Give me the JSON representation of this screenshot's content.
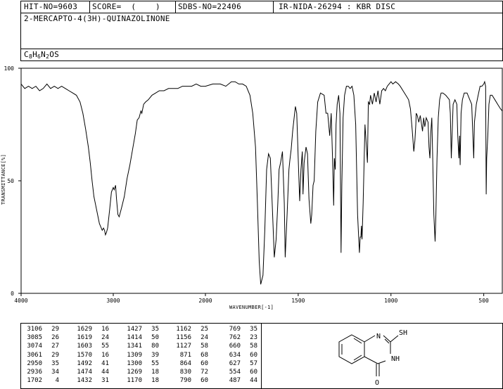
{
  "header": {
    "hit_no": "HIT-NO=9603",
    "score": "SCORE=  (    )",
    "sdbs_no": "SDBS-NO=22406",
    "ir_no": "IR-NIDA-26294 : KBR DISC",
    "compound_name": "2-MERCAPTO-4(3H)-QUINAZOLINONE",
    "formula_parts": [
      {
        "t": "C",
        "sub": false
      },
      {
        "t": "8",
        "sub": true
      },
      {
        "t": "H",
        "sub": false
      },
      {
        "t": "6",
        "sub": true
      },
      {
        "t": "N",
        "sub": false
      },
      {
        "t": "2",
        "sub": true
      },
      {
        "t": "OS",
        "sub": false
      }
    ]
  },
  "chart_data": {
    "type": "line",
    "title": "",
    "xlabel": "WAVENUMBER[-1]",
    "ylabel": "TRANSMITTANCE[%]",
    "xlim": [
      4000,
      400
    ],
    "ylim": [
      0,
      100
    ],
    "x_ticks": [
      "4000",
      "3000",
      "2000",
      "1500",
      "1000",
      "500"
    ],
    "y_ticks": [
      "100",
      "50",
      "0"
    ],
    "series": [
      {
        "points": [
          [
            4000,
            93
          ],
          [
            3960,
            91
          ],
          [
            3920,
            92
          ],
          [
            3880,
            91
          ],
          [
            3840,
            92
          ],
          [
            3800,
            90
          ],
          [
            3760,
            91
          ],
          [
            3720,
            93
          ],
          [
            3680,
            91
          ],
          [
            3640,
            92
          ],
          [
            3600,
            91
          ],
          [
            3560,
            92
          ],
          [
            3520,
            91
          ],
          [
            3480,
            90
          ],
          [
            3440,
            89
          ],
          [
            3400,
            88
          ],
          [
            3360,
            85
          ],
          [
            3330,
            80
          ],
          [
            3300,
            73
          ],
          [
            3270,
            65
          ],
          [
            3250,
            58
          ],
          [
            3230,
            50
          ],
          [
            3210,
            43
          ],
          [
            3190,
            39
          ],
          [
            3170,
            35
          ],
          [
            3150,
            31
          ],
          [
            3120,
            28
          ],
          [
            3106,
            29
          ],
          [
            3095,
            28
          ],
          [
            3085,
            26
          ],
          [
            3074,
            27
          ],
          [
            3061,
            29
          ],
          [
            3040,
            37
          ],
          [
            3020,
            45
          ],
          [
            3000,
            47
          ],
          [
            2990,
            46
          ],
          [
            2975,
            48
          ],
          [
            2965,
            42
          ],
          [
            2950,
            35
          ],
          [
            2936,
            34
          ],
          [
            2910,
            38
          ],
          [
            2880,
            43
          ],
          [
            2850,
            51
          ],
          [
            2820,
            57
          ],
          [
            2790,
            64
          ],
          [
            2760,
            71
          ],
          [
            2740,
            77
          ],
          [
            2720,
            78
          ],
          [
            2700,
            81
          ],
          [
            2690,
            80
          ],
          [
            2670,
            84
          ],
          [
            2650,
            85
          ],
          [
            2620,
            86
          ],
          [
            2580,
            88
          ],
          [
            2540,
            89
          ],
          [
            2500,
            90
          ],
          [
            2450,
            90
          ],
          [
            2400,
            91
          ],
          [
            2350,
            91
          ],
          [
            2300,
            91
          ],
          [
            2250,
            92
          ],
          [
            2200,
            92
          ],
          [
            2150,
            92
          ],
          [
            2100,
            93
          ],
          [
            2050,
            92
          ],
          [
            2000,
            92
          ],
          [
            1960,
            93
          ],
          [
            1920,
            93
          ],
          [
            1890,
            92
          ],
          [
            1860,
            94
          ],
          [
            1840,
            94
          ],
          [
            1820,
            93
          ],
          [
            1800,
            93
          ],
          [
            1780,
            92
          ],
          [
            1760,
            88
          ],
          [
            1745,
            80
          ],
          [
            1730,
            65
          ],
          [
            1720,
            40
          ],
          [
            1710,
            14
          ],
          [
            1702,
            4
          ],
          [
            1690,
            8
          ],
          [
            1680,
            28
          ],
          [
            1670,
            55
          ],
          [
            1660,
            62
          ],
          [
            1650,
            60
          ],
          [
            1640,
            40
          ],
          [
            1629,
            16
          ],
          [
            1619,
            24
          ],
          [
            1610,
            40
          ],
          [
            1603,
            55
          ],
          [
            1595,
            58
          ],
          [
            1585,
            63
          ],
          [
            1575,
            40
          ],
          [
            1570,
            16
          ],
          [
            1560,
            35
          ],
          [
            1550,
            55
          ],
          [
            1545,
            59
          ],
          [
            1538,
            64
          ],
          [
            1530,
            72
          ],
          [
            1522,
            78
          ],
          [
            1515,
            83
          ],
          [
            1508,
            80
          ],
          [
            1500,
            60
          ],
          [
            1492,
            41
          ],
          [
            1485,
            55
          ],
          [
            1478,
            63
          ],
          [
            1474,
            44
          ],
          [
            1468,
            58
          ],
          [
            1458,
            65
          ],
          [
            1450,
            62
          ],
          [
            1442,
            42
          ],
          [
            1432,
            31
          ],
          [
            1427,
            35
          ],
          [
            1420,
            48
          ],
          [
            1414,
            50
          ],
          [
            1405,
            72
          ],
          [
            1395,
            85
          ],
          [
            1380,
            89
          ],
          [
            1360,
            88
          ],
          [
            1350,
            80
          ],
          [
            1341,
            80
          ],
          [
            1330,
            70
          ],
          [
            1322,
            80
          ],
          [
            1315,
            60
          ],
          [
            1309,
            39
          ],
          [
            1305,
            60
          ],
          [
            1300,
            55
          ],
          [
            1296,
            75
          ],
          [
            1290,
            84
          ],
          [
            1282,
            88
          ],
          [
            1275,
            80
          ],
          [
            1270,
            30
          ],
          [
            1269,
            18
          ],
          [
            1265,
            48
          ],
          [
            1258,
            78
          ],
          [
            1250,
            88
          ],
          [
            1240,
            92
          ],
          [
            1230,
            92
          ],
          [
            1220,
            91
          ],
          [
            1210,
            92
          ],
          [
            1200,
            88
          ],
          [
            1190,
            75
          ],
          [
            1180,
            35
          ],
          [
            1170,
            18
          ],
          [
            1166,
            25
          ],
          [
            1162,
            25
          ],
          [
            1159,
            30
          ],
          [
            1156,
            24
          ],
          [
            1150,
            40
          ],
          [
            1140,
            75
          ],
          [
            1127,
            58
          ],
          [
            1122,
            85
          ],
          [
            1115,
            84
          ],
          [
            1110,
            88
          ],
          [
            1100,
            84
          ],
          [
            1090,
            89
          ],
          [
            1080,
            85
          ],
          [
            1070,
            90
          ],
          [
            1060,
            84
          ],
          [
            1050,
            90
          ],
          [
            1040,
            91
          ],
          [
            1030,
            90
          ],
          [
            1020,
            92
          ],
          [
            1010,
            93
          ],
          [
            1000,
            94
          ],
          [
            990,
            93
          ],
          [
            975,
            94
          ],
          [
            960,
            93
          ],
          [
            950,
            92
          ],
          [
            935,
            90
          ],
          [
            920,
            88
          ],
          [
            905,
            86
          ],
          [
            895,
            82
          ],
          [
            885,
            72
          ],
          [
            877,
            63
          ],
          [
            871,
            68
          ],
          [
            866,
            75
          ],
          [
            864,
            80
          ],
          [
            858,
            79
          ],
          [
            850,
            76
          ],
          [
            842,
            79
          ],
          [
            830,
            72
          ],
          [
            824,
            78
          ],
          [
            818,
            74
          ],
          [
            810,
            78
          ],
          [
            800,
            76
          ],
          [
            795,
            65
          ],
          [
            790,
            60
          ],
          [
            785,
            72
          ],
          [
            780,
            78
          ],
          [
            775,
            60
          ],
          [
            769,
            35
          ],
          [
            765,
            28
          ],
          [
            762,
            23
          ],
          [
            758,
            35
          ],
          [
            752,
            60
          ],
          [
            745,
            78
          ],
          [
            738,
            86
          ],
          [
            730,
            89
          ],
          [
            720,
            89
          ],
          [
            705,
            88
          ],
          [
            695,
            87
          ],
          [
            685,
            86
          ],
          [
            680,
            80
          ],
          [
            675,
            60
          ],
          [
            670,
            72
          ],
          [
            665,
            84
          ],
          [
            655,
            86
          ],
          [
            645,
            84
          ],
          [
            640,
            70
          ],
          [
            634,
            60
          ],
          [
            630,
            70
          ],
          [
            627,
            57
          ],
          [
            622,
            80
          ],
          [
            615,
            86
          ],
          [
            605,
            89
          ],
          [
            590,
            89
          ],
          [
            575,
            86
          ],
          [
            565,
            84
          ],
          [
            554,
            60
          ],
          [
            550,
            76
          ],
          [
            540,
            84
          ],
          [
            530,
            88
          ],
          [
            520,
            92
          ],
          [
            510,
            92
          ],
          [
            500,
            93
          ],
          [
            495,
            94
          ],
          [
            490,
            92
          ],
          [
            487,
            44
          ],
          [
            484,
            60
          ],
          [
            478,
            70
          ],
          [
            472,
            84
          ],
          [
            465,
            88
          ],
          [
            455,
            88
          ],
          [
            440,
            86
          ],
          [
            425,
            84
          ],
          [
            410,
            82
          ],
          [
            400,
            81
          ]
        ]
      }
    ]
  },
  "peak_table": {
    "columns": [
      [
        [
          "3106",
          "29"
        ],
        [
          "3085",
          "26"
        ],
        [
          "3074",
          "27"
        ],
        [
          "3061",
          "29"
        ],
        [
          "2950",
          "35"
        ],
        [
          "2936",
          "34"
        ],
        [
          "1702",
          "4"
        ]
      ],
      [
        [
          "1629",
          "16"
        ],
        [
          "1619",
          "24"
        ],
        [
          "1603",
          "55"
        ],
        [
          "1570",
          "16"
        ],
        [
          "1492",
          "41"
        ],
        [
          "1474",
          "44"
        ],
        [
          "1432",
          "31"
        ]
      ],
      [
        [
          "1427",
          "35"
        ],
        [
          "1414",
          "50"
        ],
        [
          "1341",
          "80"
        ],
        [
          "1309",
          "39"
        ],
        [
          "1300",
          "55"
        ],
        [
          "1269",
          "18"
        ],
        [
          "1170",
          "18"
        ]
      ],
      [
        [
          "1162",
          "25"
        ],
        [
          "1156",
          "24"
        ],
        [
          "1127",
          "58"
        ],
        [
          "871",
          "68"
        ],
        [
          "864",
          "60"
        ],
        [
          "830",
          "72"
        ],
        [
          "790",
          "60"
        ]
      ],
      [
        [
          "769",
          "35"
        ],
        [
          "762",
          "23"
        ],
        [
          "660",
          "58"
        ],
        [
          "634",
          "60"
        ],
        [
          "627",
          "57"
        ],
        [
          "554",
          "60"
        ],
        [
          "487",
          "44"
        ]
      ]
    ]
  },
  "structure": {
    "labels": [
      "N",
      "SH",
      "NH",
      "O"
    ]
  }
}
